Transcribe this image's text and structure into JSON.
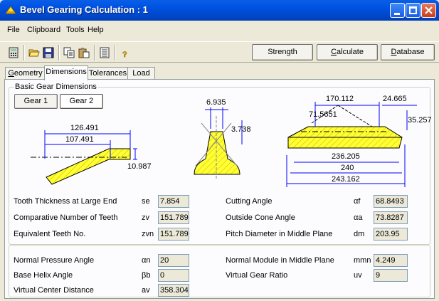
{
  "window": {
    "title": "Bevel Gearing Calculation : 1"
  },
  "menu": [
    "File",
    "Clipboard",
    "Tools",
    "Help"
  ],
  "toolbar": {
    "strength": "Strength",
    "calculate": "Calculate",
    "database": "Database"
  },
  "tabs": [
    "Geometry",
    "Dimensions",
    "Tolerances",
    "Load"
  ],
  "group": {
    "title": "Basic Gear Dimensions"
  },
  "gear_buttons": [
    "Gear 1",
    "Gear 2"
  ],
  "diagram": {
    "left": {
      "d1": "126.491",
      "d2": "107.491",
      "d3": "10.987"
    },
    "tooth": {
      "w": "6.935",
      "h": "3.738"
    },
    "right": {
      "a": "170.112",
      "b": "24.665",
      "c": "71.5651",
      "d": "35.257",
      "e": "236.205",
      "f": "240",
      "g": "243.162"
    }
  },
  "rows1": [
    {
      "label": "Tooth Thickness at Large End",
      "sym": "se",
      "value": "7.854",
      "label2": "Cutting Angle",
      "sym2": "αf",
      "value2": "68.8493"
    },
    {
      "label": "Comparative Number of Teeth",
      "sym": "zv",
      "value": "151.789",
      "label2": "Outside Cone Angle",
      "sym2": "αa",
      "value2": "73.8287"
    },
    {
      "label": "Equivalent Teeth No.",
      "sym": "zvn",
      "value": "151.789",
      "label2": "Pitch Diameter in Middle Plane",
      "sym2": "dm",
      "value2": "203.95"
    }
  ],
  "rows2": [
    {
      "label": "Normal Pressure Angle",
      "sym": "αn",
      "value": "20",
      "label2": "Normal Module in Middle Plane",
      "sym2": "mmn",
      "value2": "4.249"
    },
    {
      "label": "Base Helix Angle",
      "sym": "βb",
      "value": "0",
      "label2": "Virtual Gear Ratio",
      "sym2": "uv",
      "value2": "9"
    },
    {
      "label": "Virtual Center Distance",
      "sym": "av",
      "value": "358.304"
    }
  ],
  "colors": {
    "title_bar": "#0054e3",
    "gear_fill": "#ffff33",
    "dim_line": "#0000ff"
  }
}
